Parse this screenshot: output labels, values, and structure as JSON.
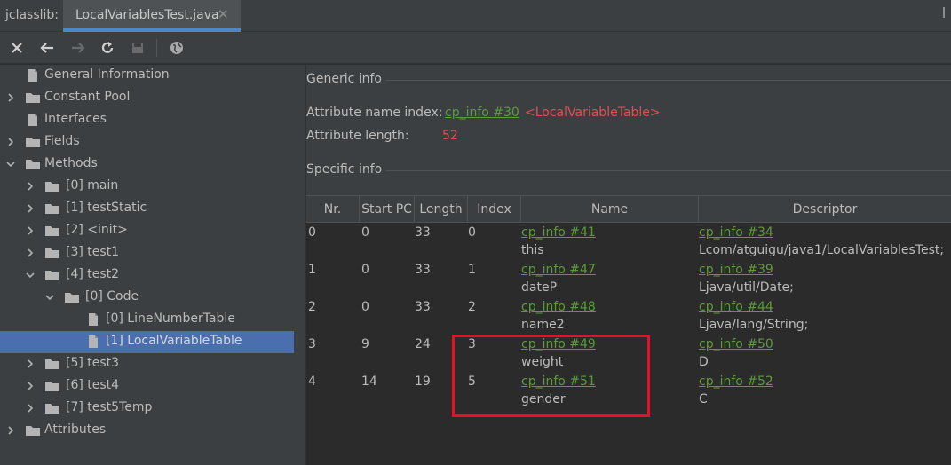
{
  "header": {
    "tool": "jclasslib:",
    "tab_label": "LocalVariablesTest.java",
    "tab_close": "✕"
  },
  "toolbar": {
    "icons": [
      "close-icon",
      "back-icon",
      "forward-icon",
      "refresh-icon",
      "save-icon",
      "web-icon"
    ]
  },
  "tree": {
    "items": [
      {
        "label": "General Information",
        "level": 0,
        "expand": "none",
        "icon": "file"
      },
      {
        "label": "Constant Pool",
        "level": 0,
        "expand": "collapsed",
        "icon": "folder"
      },
      {
        "label": "Interfaces",
        "level": 0,
        "expand": "none",
        "icon": "file"
      },
      {
        "label": "Fields",
        "level": 0,
        "expand": "collapsed",
        "icon": "folder"
      },
      {
        "label": "Methods",
        "level": 0,
        "expand": "expanded",
        "icon": "folder"
      },
      {
        "label": "[0] main",
        "level": 1,
        "expand": "collapsed",
        "icon": "folder"
      },
      {
        "label": "[1] testStatic",
        "level": 1,
        "expand": "collapsed",
        "icon": "folder"
      },
      {
        "label": "[2] <init>",
        "level": 1,
        "expand": "collapsed",
        "icon": "folder"
      },
      {
        "label": "[3] test1",
        "level": 1,
        "expand": "collapsed",
        "icon": "folder"
      },
      {
        "label": "[4] test2",
        "level": 1,
        "expand": "expanded",
        "icon": "folder"
      },
      {
        "label": "[0] Code",
        "level": 2,
        "expand": "expanded",
        "icon": "folder"
      },
      {
        "label": "[0] LineNumberTable",
        "level": 3,
        "expand": "none",
        "icon": "file"
      },
      {
        "label": "[1] LocalVariableTable",
        "level": 3,
        "expand": "none",
        "icon": "file",
        "selected": true
      },
      {
        "label": "[5] test3",
        "level": 1,
        "expand": "collapsed",
        "icon": "folder"
      },
      {
        "label": "[6] test4",
        "level": 1,
        "expand": "collapsed",
        "icon": "folder"
      },
      {
        "label": "[7] test5Temp",
        "level": 1,
        "expand": "collapsed",
        "icon": "folder"
      },
      {
        "label": "Attributes",
        "level": 0,
        "expand": "collapsed",
        "icon": "folder"
      }
    ]
  },
  "generic": {
    "title": "Generic info",
    "name_index_label": "Attribute name index:",
    "name_index_link": "cp_info #30",
    "name_index_value": "<LocalVariableTable>",
    "length_label": "Attribute length:",
    "length_value": "52"
  },
  "specific": {
    "title": "Specific info"
  },
  "table": {
    "columns": [
      "Nr.",
      "Start PC",
      "Length",
      "Index",
      "Name",
      "Descriptor"
    ],
    "rows": [
      {
        "nr": "0",
        "start_pc": "0",
        "length": "33",
        "index": "0",
        "name_link": "cp_info #41",
        "name": "this",
        "desc_link": "cp_info #34",
        "desc": "Lcom/atguigu/java1/LocalVariablesTest;"
      },
      {
        "nr": "1",
        "start_pc": "0",
        "length": "33",
        "index": "1",
        "name_link": "cp_info #47",
        "name": "dateP",
        "desc_link": "cp_info #39",
        "desc": "Ljava/util/Date;"
      },
      {
        "nr": "2",
        "start_pc": "0",
        "length": "33",
        "index": "2",
        "name_link": "cp_info #48",
        "name": "name2",
        "desc_link": "cp_info #44",
        "desc": "Ljava/lang/String;"
      },
      {
        "nr": "3",
        "start_pc": "9",
        "length": "24",
        "index": "3",
        "name_link": "cp_info #49",
        "name": "weight",
        "desc_link": "cp_info #50",
        "desc": "D"
      },
      {
        "nr": "4",
        "start_pc": "14",
        "length": "19",
        "index": "5",
        "name_link": "cp_info #51",
        "name": "gender",
        "desc_link": "cp_info #52",
        "desc": "C"
      }
    ]
  },
  "colors": {
    "link_green": "#5c9b3a",
    "value_red": "#e05050",
    "highlight_box": "#e81123",
    "selection": "#4b6eaf"
  }
}
